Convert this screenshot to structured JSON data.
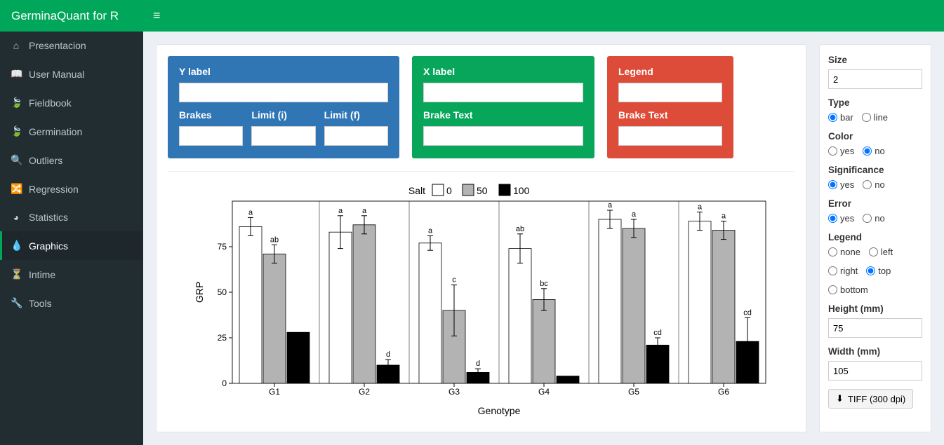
{
  "app": {
    "title": "GerminaQuant for R"
  },
  "sidebar": {
    "items": [
      {
        "label": "Presentacion",
        "icon": "⌂"
      },
      {
        "label": "User Manual",
        "icon": "📖"
      },
      {
        "label": "Fieldbook",
        "icon": "🍃"
      },
      {
        "label": "Germination",
        "icon": "🍃"
      },
      {
        "label": "Outliers",
        "icon": "🔍"
      },
      {
        "label": "Regression",
        "icon": "🔀"
      },
      {
        "label": "Statistics",
        "icon": "◕"
      },
      {
        "label": "Graphics",
        "icon": "💧"
      },
      {
        "label": "Intime",
        "icon": "⏳"
      },
      {
        "label": "Tools",
        "icon": "🔧"
      }
    ],
    "activeIndex": 7
  },
  "cards": {
    "y": {
      "title": "Y label",
      "sub1": "Brakes",
      "sub2": "Limit (i)",
      "sub3": "Limit (f)"
    },
    "x": {
      "title": "X label",
      "sub1": "Brake Text"
    },
    "legend": {
      "title": "Legend",
      "sub1": "Brake Text"
    }
  },
  "panel": {
    "size_label": "Size",
    "size_value": "2",
    "type_label": "Type",
    "type_opts": [
      "bar",
      "line"
    ],
    "type_sel": "bar",
    "color_label": "Color",
    "yn_opts": [
      "yes",
      "no"
    ],
    "color_sel": "no",
    "sig_label": "Significance",
    "sig_sel": "yes",
    "err_label": "Error",
    "err_sel": "yes",
    "legend_label": "Legend",
    "legend_opts": [
      "none",
      "left",
      "right",
      "top",
      "bottom"
    ],
    "legend_sel": "top",
    "height_label": "Height (mm)",
    "height_value": "75",
    "width_label": "Width (mm)",
    "width_value": "105",
    "download_label": "TIFF (300 dpi)"
  },
  "chart_data": {
    "type": "bar",
    "xlabel": "Genotype",
    "ylabel": "GRP",
    "ylim": [
      0,
      100
    ],
    "yticks": [
      0,
      25,
      50,
      75
    ],
    "legend_title": "Salt",
    "legend_position": "top",
    "categories": [
      "G1",
      "G2",
      "G3",
      "G4",
      "G5",
      "G6"
    ],
    "series": [
      {
        "name": "0",
        "fill": "#ffffff",
        "values": [
          86,
          83,
          77,
          74,
          90,
          89
        ],
        "err": [
          5,
          9,
          4,
          8,
          5,
          5
        ],
        "sig": [
          "a",
          "a",
          "a",
          "ab",
          "a",
          "a"
        ]
      },
      {
        "name": "50",
        "fill": "#b3b3b3",
        "values": [
          71,
          87,
          40,
          46,
          85,
          84
        ],
        "err": [
          5,
          5,
          14,
          6,
          5,
          5
        ],
        "sig": [
          "ab",
          "a",
          "c",
          "bc",
          "a",
          "a"
        ]
      },
      {
        "name": "100",
        "fill": "#000000",
        "values": [
          28,
          10,
          6,
          4,
          21,
          23
        ],
        "err": [
          0,
          3,
          2,
          0,
          4,
          13
        ],
        "sig": [
          "",
          "d",
          "d",
          "",
          "cd",
          "cd"
        ]
      }
    ]
  }
}
